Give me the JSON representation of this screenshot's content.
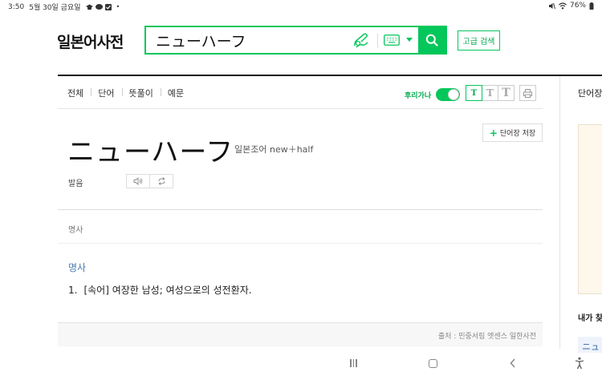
{
  "status_bar": {
    "time": "3:50",
    "date": "5월 30일 금요일",
    "extra": "•",
    "battery": "76%"
  },
  "header": {
    "logo": "일본어사전",
    "search_value": "ニューハーフ",
    "advanced_search_label": "고급 검색"
  },
  "tabs": [
    "전체",
    "단어",
    "뜻풀이",
    "예문"
  ],
  "toolbar": {
    "furigana_label": "후리가나",
    "font_buttons": [
      "T",
      "T",
      "T"
    ]
  },
  "entry": {
    "save_label": "단어장 저장",
    "headword": "ニューハーフ",
    "origin": "일본조어 new＋half",
    "pronunciation_label": "발음",
    "pos_small": "명사",
    "pos_main": "명사",
    "meaning_number": "1.",
    "meaning_text": "[속어] 여장한 남성; 여성으로의 성전환자.",
    "source": "출처 : 민중서림 엣센스 일한사전"
  },
  "right_panel": {
    "title": "단어장",
    "subtitle": "내가 찾",
    "recent_item": "ニュ"
  },
  "colors": {
    "accent": "#03c75a",
    "link_blue": "#4a7bb7"
  }
}
